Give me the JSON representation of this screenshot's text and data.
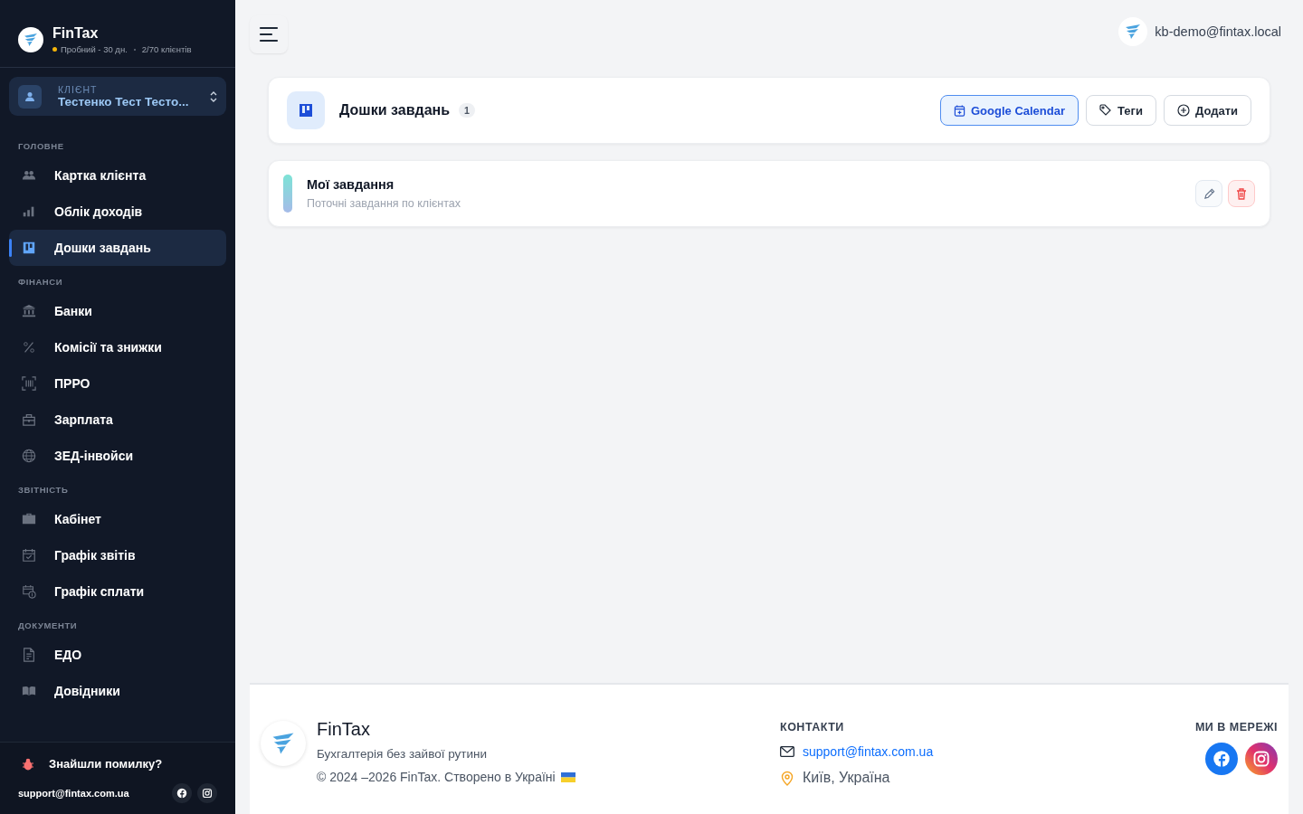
{
  "brand": {
    "name": "FinTax",
    "plan": "Пробний - 30 дн.",
    "clients": "2/70 клієнтів"
  },
  "client_selector": {
    "label": "КЛІЄНТ",
    "value": "Тестенко Тест Тесто..."
  },
  "sidebar": {
    "sections": [
      {
        "title": "ГОЛОВНЕ",
        "items": [
          {
            "label": "Картка клієнта",
            "selected": false
          },
          {
            "label": "Облік доходів",
            "selected": false
          },
          {
            "label": "Дошки завдань",
            "selected": true
          }
        ]
      },
      {
        "title": "ФІНАНСИ",
        "items": [
          {
            "label": "Банки",
            "selected": false
          },
          {
            "label": "Комісії та знижки",
            "selected": false
          },
          {
            "label": "ПРРО",
            "selected": false
          },
          {
            "label": "Зарплата",
            "selected": false
          },
          {
            "label": "ЗЕД-інвойси",
            "selected": false
          }
        ]
      },
      {
        "title": "ЗВІТНІСТЬ",
        "items": [
          {
            "label": "Кабінет",
            "selected": false
          },
          {
            "label": "Графік звітів",
            "selected": false
          },
          {
            "label": "Графік сплати",
            "selected": false
          }
        ]
      },
      {
        "title": "ДОКУМЕНТИ",
        "items": [
          {
            "label": "ЕДО",
            "selected": false
          },
          {
            "label": "Довідники",
            "selected": false
          }
        ]
      }
    ]
  },
  "sidebar_footer": {
    "report_bug": "Знайшли помилку?",
    "email": "support@fintax.com.ua"
  },
  "topbar": {
    "user": "kb-demo@fintax.local"
  },
  "page_header": {
    "title": "Дошки завдань",
    "count": "1",
    "buttons": [
      {
        "label": "Google Calendar",
        "kind": "primary"
      },
      {
        "label": "Теги",
        "kind": "tags"
      },
      {
        "label": "Додати",
        "kind": "add"
      }
    ]
  },
  "boards": [
    {
      "title": "Мої завдання",
      "description": "Поточні завдання по клієнтах"
    }
  ],
  "footer": {
    "name": "FinTax",
    "tagline": "Бухгалтерія без зайвої рутини",
    "copyright": "© 2024 –2026 FinTax. Створено в Україні",
    "contacts_title": "КОНТАКТИ",
    "email": "support@fintax.com.ua",
    "location": "Київ, Україна",
    "social_title": "МИ В МЕРЕЖІ"
  }
}
